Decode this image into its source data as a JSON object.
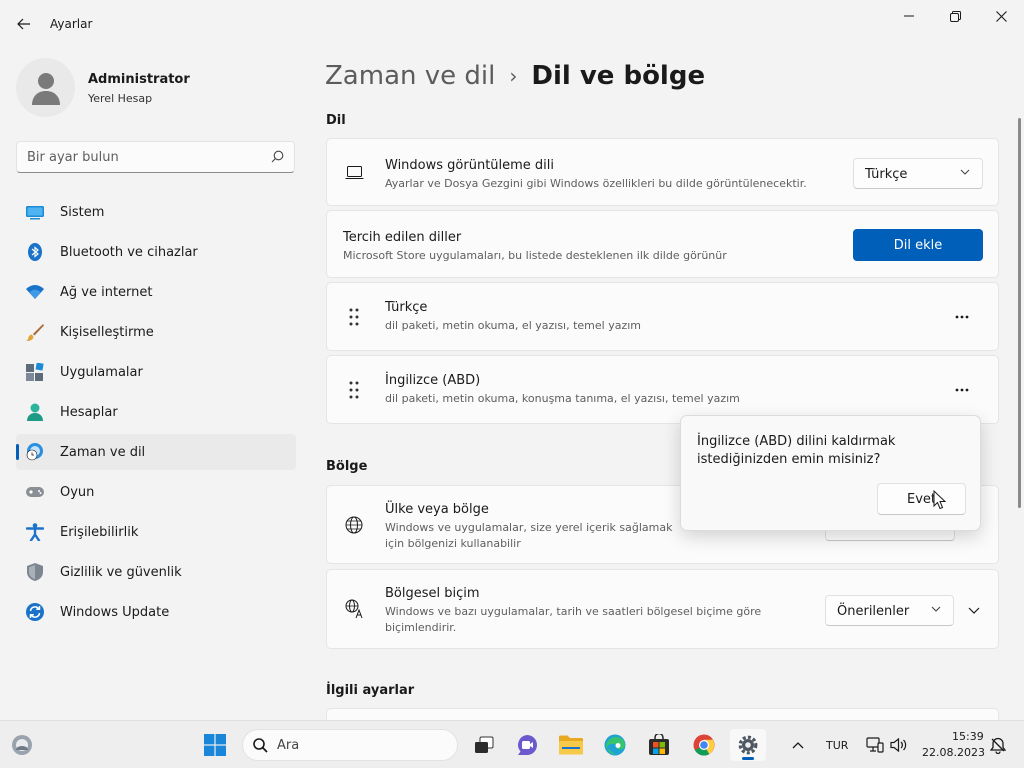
{
  "window": {
    "app_title": "Ayarlar",
    "controls": {
      "minimize": "minimize-icon",
      "maximize": "restore-icon",
      "close": "close-icon"
    }
  },
  "profile": {
    "name": "Administrator",
    "account": "Yerel Hesap"
  },
  "search": {
    "placeholder": "Bir ayar bulun"
  },
  "sidebar": {
    "items": [
      {
        "label": "Sistem",
        "icon": "system-icon"
      },
      {
        "label": "Bluetooth ve cihazlar",
        "icon": "bluetooth-icon"
      },
      {
        "label": "Ağ ve internet",
        "icon": "wifi-icon"
      },
      {
        "label": "Kişiselleştirme",
        "icon": "brush-icon"
      },
      {
        "label": "Uygulamalar",
        "icon": "apps-icon"
      },
      {
        "label": "Hesaplar",
        "icon": "accounts-icon"
      },
      {
        "label": "Zaman ve dil",
        "icon": "time-language-icon",
        "active": true
      },
      {
        "label": "Oyun",
        "icon": "gaming-icon"
      },
      {
        "label": "Erişilebilirlik",
        "icon": "accessibility-icon"
      },
      {
        "label": "Gizlilik ve güvenlik",
        "icon": "shield-icon"
      },
      {
        "label": "Windows Update",
        "icon": "update-icon"
      }
    ]
  },
  "breadcrumb": {
    "parent": "Zaman ve dil",
    "separator": "›",
    "current": "Dil ve bölge"
  },
  "language": {
    "section_title": "Dil",
    "display": {
      "title": "Windows görüntüleme dili",
      "description": "Ayarlar ve Dosya Gezgini gibi Windows özellikleri bu dilde görüntülenecektir.",
      "value": "Türkçe"
    },
    "preferred": {
      "title": "Tercih edilen diller",
      "description": "Microsoft Store uygulamaları, bu listede desteklenen ilk dilde görünür",
      "button": "Dil ekle"
    },
    "items": [
      {
        "title": "Türkçe",
        "description": "dil paketi, metin okuma, el yazısı, temel yazım"
      },
      {
        "title": "İngilizce (ABD)",
        "description": "dil paketi, metin okuma, konuşma tanıma, el yazısı, temel yazım"
      }
    ]
  },
  "region": {
    "section_title": "Bölge",
    "country": {
      "title": "Ülke veya bölge",
      "description": "Windows ve uygulamalar, size yerel içerik sağlamak için bölgenizi kullanabilir"
    },
    "format": {
      "title": "Bölgesel biçim",
      "description": "Windows ve bazı uygulamalar, tarih ve saatleri bölgesel biçime göre biçimlendirir.",
      "value": "Önerilenler"
    }
  },
  "related": {
    "section_title": "İlgili ayarlar"
  },
  "flyout": {
    "message": "İngilizce (ABD) dilini kaldırmak istediğinizden emin misiniz?",
    "confirm": "Evet"
  },
  "taskbar": {
    "search_placeholder": "Ara",
    "language": "TUR",
    "time": "15:39",
    "date": "22.08.2023"
  },
  "colors": {
    "accent": "#005fb8",
    "background": "#f3f3f3",
    "card": "#fbfbfb"
  }
}
